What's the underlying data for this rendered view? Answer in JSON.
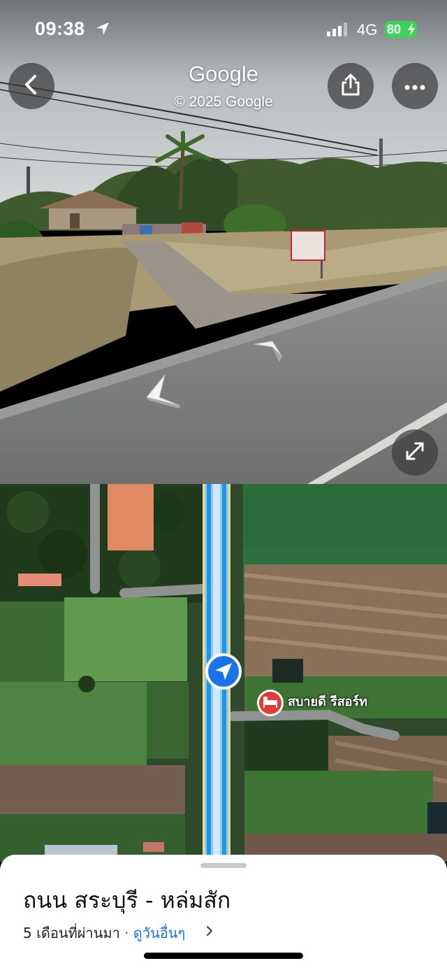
{
  "status_bar": {
    "time": "09:38",
    "network": "4G",
    "battery": "80",
    "icons": [
      "location-arrow-icon",
      "signal-bars-icon",
      "charging-bolt-icon"
    ]
  },
  "street_view": {
    "brand": "Google",
    "copyright": "© 2025 Google",
    "buttons": [
      "back-arrow-icon",
      "share-icon",
      "more-dots-icon",
      "expand-icon"
    ]
  },
  "map": {
    "place_pin_label": "สบายดี รีสอร์ท",
    "pin_icon": "hotel-bed-icon",
    "pin_color": "#e53935",
    "location_marker_color": "#1a73e8"
  },
  "sheet": {
    "title": "ถนน สระบุรี - หล่มสัก",
    "date": "5 เดือนที่ผ่านมา",
    "separator": "·",
    "link": "ดูวันอื่นๆ"
  },
  "colors": {
    "accent": "#1a73e8",
    "battery": "#3fd25b"
  }
}
